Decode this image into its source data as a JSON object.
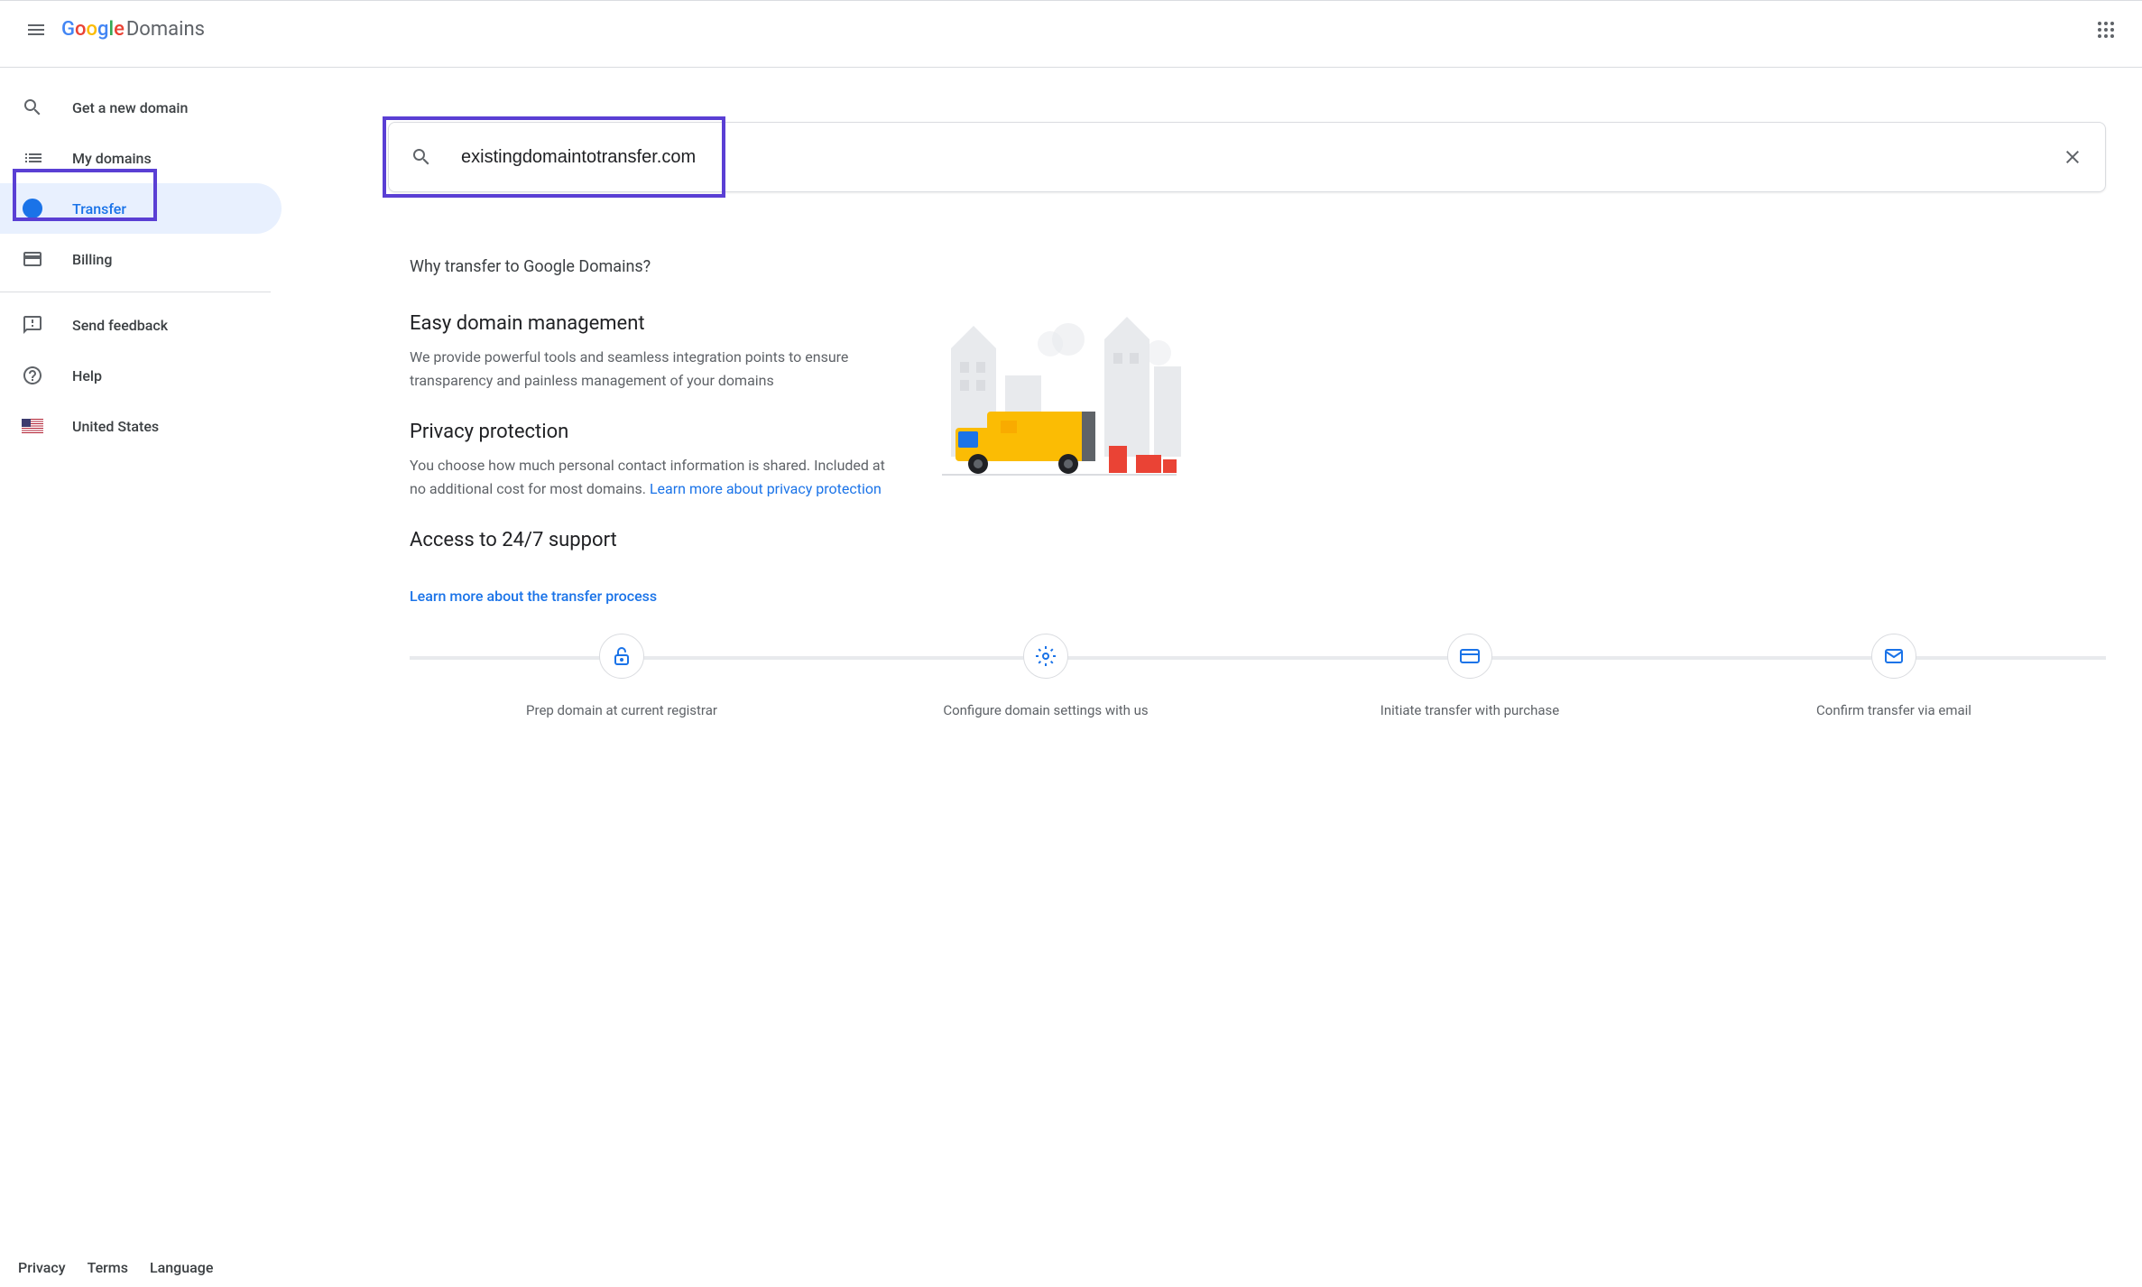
{
  "header": {
    "product_name": "Domains"
  },
  "sidebar": {
    "items": [
      {
        "label": "Get a new domain"
      },
      {
        "label": "My domains"
      },
      {
        "label": "Transfer"
      },
      {
        "label": "Billing"
      },
      {
        "label": "Send feedback"
      },
      {
        "label": "Help"
      },
      {
        "label": "United States"
      }
    ]
  },
  "footer": {
    "privacy": "Privacy",
    "terms": "Terms",
    "language": "Language"
  },
  "search": {
    "value": "existingdomaintotransfer.com"
  },
  "why": {
    "title": "Why transfer to Google Domains?",
    "features": [
      {
        "heading": "Easy domain management",
        "body": "We provide powerful tools and seamless integration points to ensure transparency and painless management of your domains"
      },
      {
        "heading": "Privacy protection",
        "body": "You choose how much personal contact information is shared. Included at no additional cost for most domains. ",
        "link": "Learn more about privacy protection"
      },
      {
        "heading": "Access to 24/7 support",
        "body": ""
      }
    ],
    "learn_more": "Learn more about the transfer process"
  },
  "steps": [
    {
      "label": "Prep domain at current registrar"
    },
    {
      "label": "Configure domain settings with us"
    },
    {
      "label": "Initiate transfer with purchase"
    },
    {
      "label": "Confirm transfer via email"
    }
  ]
}
